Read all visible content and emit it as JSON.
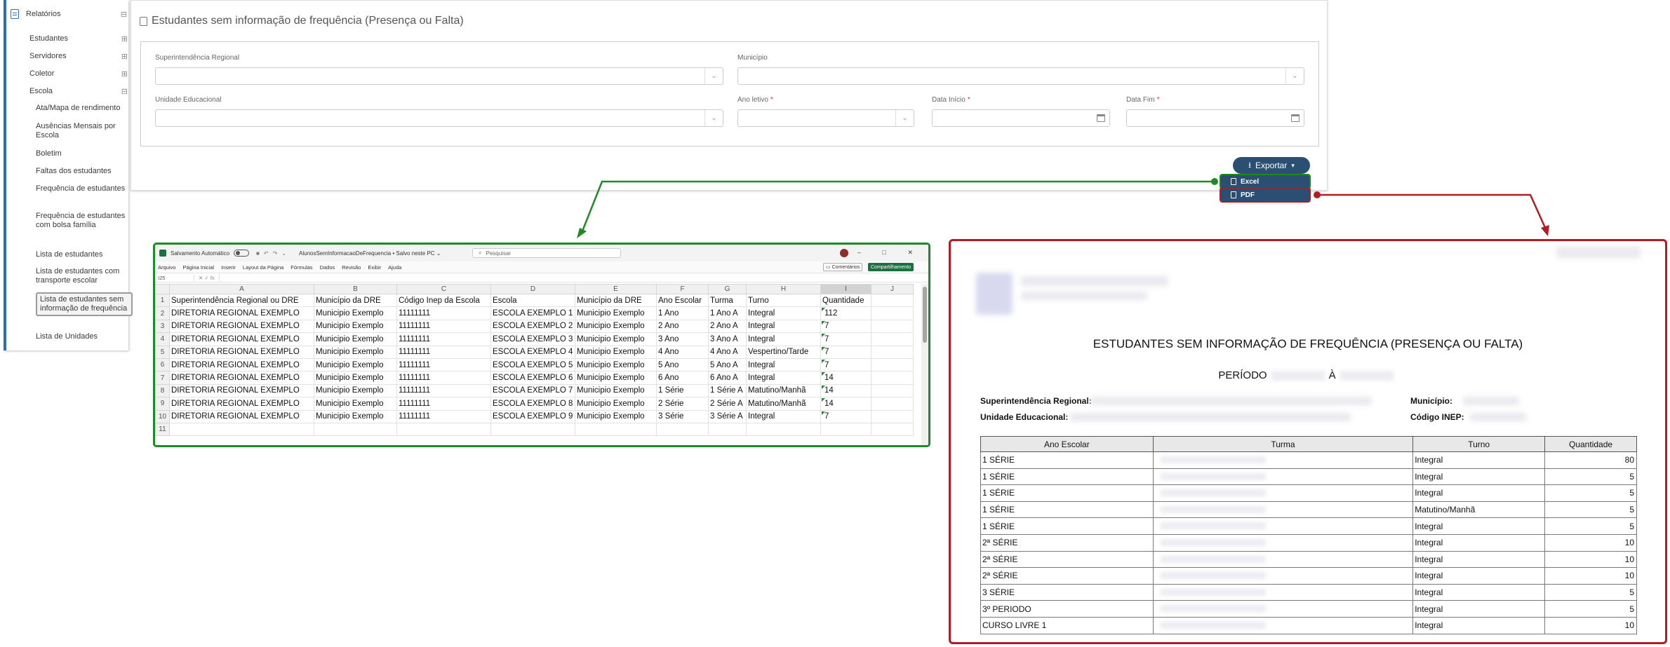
{
  "sidebar": {
    "root_label": "Relatórios",
    "root_toggle": "⊟",
    "items": [
      {
        "label": "Estudantes",
        "toggle": "⊞"
      },
      {
        "label": "Servidores",
        "toggle": "⊞"
      },
      {
        "label": "Coletor",
        "toggle": "⊞"
      },
      {
        "label": "Escola",
        "toggle": "⊟"
      }
    ],
    "escola_children": [
      "Ata/Mapa de rendimento",
      "Ausências Mensais por Escola",
      "Boletim",
      "Faltas dos estudantes",
      "Frequência de estudantes",
      "Frequência de estudantes com bolsa família",
      "Lista de estudantes",
      "Lista de estudantes com transporte escolar",
      "Lista de estudantes sem informação de frequência",
      "Lista de Unidades"
    ]
  },
  "form": {
    "title": "Estudantes sem informação de frequência (Presença ou Falta)",
    "labels": {
      "superintendencia": "Superintendência Regional",
      "municipio": "Município",
      "unidade": "Unidade Educacional",
      "ano_letivo": "Ano letivo",
      "data_inicio": "Data Início",
      "data_fim": "Data Fim"
    },
    "required_mark": "*",
    "export_label": "Exportar",
    "export_menu": {
      "excel": "Excel",
      "pdf": "PDF"
    }
  },
  "excel": {
    "autosave_label": "Salvamento Automático",
    "file_name": "AlunosSemInformacaoDeFrequencia • Salvo neste PC ⌄",
    "search_placeholder": "Pesquisar",
    "window_buttons": "–  □  ✕",
    "menu": [
      "Arquivo",
      "Página Inicial",
      "Inserir",
      "Layout da Página",
      "Fórmulas",
      "Dados",
      "Revisão",
      "Exibir",
      "Ajuda"
    ],
    "comments_label": "Comentários",
    "share_label": "Compartilhamento",
    "name_box": "I25",
    "columns": [
      "A",
      "B",
      "C",
      "D",
      "E",
      "F",
      "G",
      "H",
      "I",
      "J"
    ],
    "header_row": [
      "Superintendência Regional ou DRE",
      "Município da DRE",
      "Código Inep da Escola",
      "Escola",
      "Município da DRE",
      "Ano Escolar",
      "Turma",
      "Turno",
      "Quantidade",
      ""
    ],
    "rows": [
      [
        "DIRETORIA REGIONAL EXEMPLO",
        "Municipio Exemplo",
        "11111111",
        "ESCOLA EXEMPLO 1",
        "Municipio Exemplo",
        "1 Ano",
        "1 Ano A",
        "Integral",
        "112",
        ""
      ],
      [
        "DIRETORIA REGIONAL EXEMPLO",
        "Municipio Exemplo",
        "11111111",
        "ESCOLA EXEMPLO 2",
        "Municipio Exemplo",
        "2 Ano",
        "2 Ano A",
        "Integral",
        "7",
        ""
      ],
      [
        "DIRETORIA REGIONAL EXEMPLO",
        "Municipio Exemplo",
        "11111111",
        "ESCOLA EXEMPLO 3",
        "Municipio Exemplo",
        "3 Ano",
        "3 Ano A",
        "Integral",
        "7",
        ""
      ],
      [
        "DIRETORIA REGIONAL EXEMPLO",
        "Municipio Exemplo",
        "11111111",
        "ESCOLA EXEMPLO 4",
        "Municipio Exemplo",
        "4 Ano",
        "4 Ano A",
        "Vespertino/Tarde",
        "7",
        ""
      ],
      [
        "DIRETORIA REGIONAL EXEMPLO",
        "Municipio Exemplo",
        "11111111",
        "ESCOLA EXEMPLO 5",
        "Municipio Exemplo",
        "5 Ano",
        "5 Ano A",
        "Integral",
        "7",
        ""
      ],
      [
        "DIRETORIA REGIONAL EXEMPLO",
        "Municipio Exemplo",
        "11111111",
        "ESCOLA EXEMPLO 6",
        "Municipio Exemplo",
        "6 Ano",
        "6 Ano A",
        "Integral",
        "14",
        ""
      ],
      [
        "DIRETORIA REGIONAL EXEMPLO",
        "Municipio Exemplo",
        "11111111",
        "ESCOLA EXEMPLO 7",
        "Municipio Exemplo",
        "1 Série",
        "1 Série A",
        "Matutino/Manhã",
        "14",
        ""
      ],
      [
        "DIRETORIA REGIONAL EXEMPLO",
        "Municipio Exemplo",
        "11111111",
        "ESCOLA EXEMPLO 8",
        "Municipio Exemplo",
        "2 Série",
        "2 Série A",
        "Matutino/Manhã",
        "14",
        ""
      ],
      [
        "DIRETORIA REGIONAL EXEMPLO",
        "Municipio Exemplo",
        "11111111",
        "ESCOLA EXEMPLO 9",
        "Municipio Exemplo",
        "3 Série",
        "3 Série A",
        "Integral",
        "7",
        ""
      ]
    ]
  },
  "pdf": {
    "title": "ESTUDANTES SEM INFORMAÇÃO DE FREQUÊNCIA (PRESENÇA OU FALTA)",
    "period_label": "PERÍODO",
    "period_sep": "À",
    "labels": {
      "superintendencia": "Superintendência Regional:",
      "unidade": "Unidade Educacional:",
      "municipio": "Município:",
      "inep": "Código INEP:"
    },
    "table_headers": [
      "Ano Escolar",
      "Turma",
      "Turno",
      "Quantidade"
    ],
    "rows": [
      {
        "ano": "1 SÉRIE",
        "turno": "Integral",
        "qtd": "80"
      },
      {
        "ano": "1 SÉRIE",
        "turno": "Integral",
        "qtd": "5"
      },
      {
        "ano": "1 SÉRIE",
        "turno": "Integral",
        "qtd": "5"
      },
      {
        "ano": "1 SÉRIE",
        "turno": "Matutino/Manhã",
        "qtd": "5"
      },
      {
        "ano": "1 SÉRIE",
        "turno": "Integral",
        "qtd": "5"
      },
      {
        "ano": "2ª SÉRIE",
        "turno": "Integral",
        "qtd": "10"
      },
      {
        "ano": "2ª SÉRIE",
        "turno": "Integral",
        "qtd": "10"
      },
      {
        "ano": "2ª SÉRIE",
        "turno": "Integral",
        "qtd": "10"
      },
      {
        "ano": "3 SÉRIE",
        "turno": "Integral",
        "qtd": "5"
      },
      {
        "ano": "3º PERIODO",
        "turno": "Integral",
        "qtd": "5"
      },
      {
        "ano": "CURSO LIVRE 1",
        "turno": "Integral",
        "qtd": "10"
      }
    ]
  },
  "colors": {
    "excel_frame": "#1f8a27",
    "pdf_frame": "#b11d24",
    "export_button": "#2b4e73",
    "sidebar_accent": "#2f6db5"
  }
}
